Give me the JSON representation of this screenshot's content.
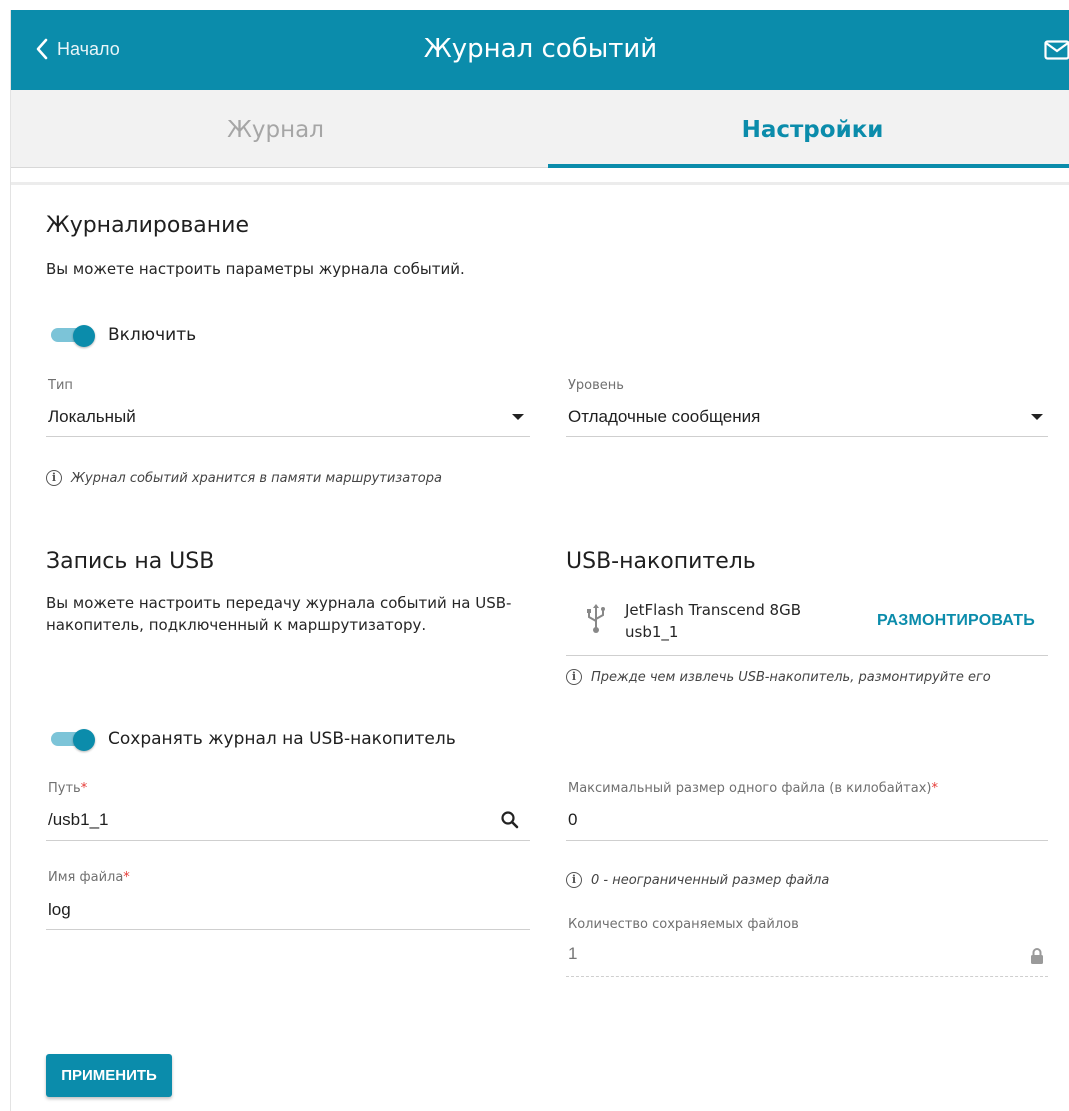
{
  "header": {
    "back_label": "Начало",
    "title": "Журнал событий"
  },
  "tabs": [
    {
      "label": "Журнал",
      "active": false
    },
    {
      "label": "Настройки",
      "active": true
    }
  ],
  "logging": {
    "title": "Журналирование",
    "description": "Вы можете настроить параметры журнала событий.",
    "enable_label": "Включить",
    "enable_on": true,
    "type": {
      "label": "Тип",
      "value": "Локальный"
    },
    "level": {
      "label": "Уровень",
      "value": "Отладочные сообщения"
    },
    "hint": "Журнал событий хранится в памяти маршрутизатора"
  },
  "usb_write": {
    "title": "Запись на USB",
    "description_line1": "Вы можете настроить передачу журнала событий на USB-",
    "description_line2": "накопитель, подключенный к маршрутизатору.",
    "save_label": "Сохранять журнал на USB-накопитель",
    "save_on": true,
    "path": {
      "label": "Путь",
      "required": "*",
      "value": "/usb1_1"
    },
    "filename": {
      "label": "Имя файла",
      "required": "*",
      "value": "log"
    }
  },
  "usb_drive": {
    "title": "USB-накопитель",
    "device_name": "JetFlash Transcend 8GB",
    "device_id": "usb1_1",
    "unmount_label": "РАЗМОНТИРОВАТЬ",
    "hint": "Прежде чем извлечь USB-накопитель, размонтируйте его",
    "max_size": {
      "label": "Максимальный размер одного файла (в килобайтах)",
      "required": "*",
      "value": "0"
    },
    "max_size_hint": "0 - неограниченный размер файла",
    "files_count": {
      "label": "Количество сохраняемых файлов",
      "value": "1"
    }
  },
  "apply_label": "ПРИМЕНИТЬ",
  "colors": {
    "accent": "#0b8cab",
    "required": "#e53935"
  }
}
